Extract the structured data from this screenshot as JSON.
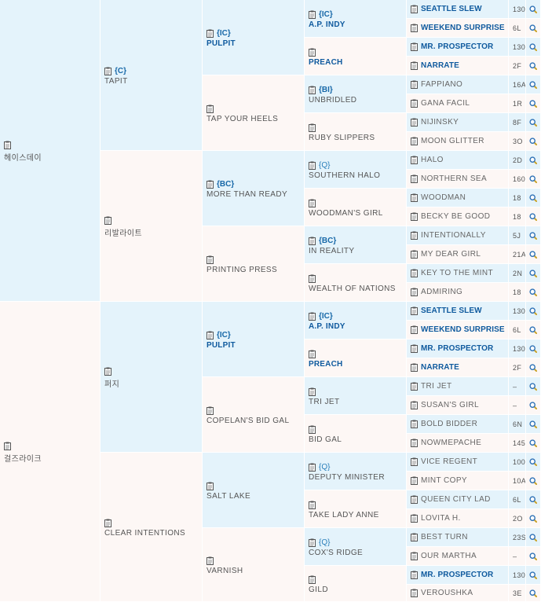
{
  "colors": {
    "male_bg": "#e4f3fb",
    "female_bg": "#fdf7f5",
    "link": "#0f5a9e"
  },
  "icons": {
    "record": "clipboard-icon",
    "search": "magnifier-icon"
  },
  "gen1": [
    {
      "name": "헤이스데이",
      "sex": "m"
    },
    {
      "name": "걸즈라이크",
      "sex": "f"
    }
  ],
  "gen2": [
    {
      "code": "{C}",
      "name": "TAPIT",
      "sex": "m"
    },
    {
      "code": "",
      "name": "리발라이트",
      "sex": "f"
    },
    {
      "code": "",
      "name": "퍼지",
      "sex": "m"
    },
    {
      "code": "",
      "name": "CLEAR INTENTIONS",
      "sex": "f"
    }
  ],
  "gen3": [
    {
      "code": "{IC}",
      "name": "PULPIT",
      "bold": true,
      "sex": "m"
    },
    {
      "code": "",
      "name": "TAP YOUR HEELS",
      "sex": "f"
    },
    {
      "code": "{BC}",
      "name": "MORE THAN READY",
      "sex": "m"
    },
    {
      "code": "",
      "name": "PRINTING PRESS",
      "sex": "f"
    },
    {
      "code": "{IC}",
      "name": "PULPIT",
      "bold": true,
      "sex": "m"
    },
    {
      "code": "",
      "name": "COPELAN'S BID GAL",
      "sex": "f"
    },
    {
      "code": "",
      "name": "SALT LAKE",
      "sex": "m"
    },
    {
      "code": "",
      "name": "VARNISH",
      "sex": "f"
    }
  ],
  "gen4": [
    {
      "code": "{IC}",
      "name": "A.P. INDY",
      "bold": true,
      "sex": "m"
    },
    {
      "code": "",
      "name": "PREACH",
      "bold": true,
      "sex": "f"
    },
    {
      "code": "{BI}",
      "name": "UNBRIDLED",
      "sex": "m"
    },
    {
      "code": "",
      "name": "RUBY SLIPPERS",
      "sex": "f"
    },
    {
      "code": "{Q}",
      "name": "SOUTHERN HALO",
      "thin": true,
      "sex": "m"
    },
    {
      "code": "",
      "name": "WOODMAN'S GIRL",
      "sex": "f"
    },
    {
      "code": "{BC}",
      "name": "IN REALITY",
      "sex": "m"
    },
    {
      "code": "",
      "name": "WEALTH OF NATIONS",
      "sex": "f"
    },
    {
      "code": "{IC}",
      "name": "A.P. INDY",
      "bold": true,
      "sex": "m"
    },
    {
      "code": "",
      "name": "PREACH",
      "bold": true,
      "sex": "f"
    },
    {
      "code": "",
      "name": "TRI JET",
      "sex": "m"
    },
    {
      "code": "",
      "name": "BID GAL",
      "sex": "f"
    },
    {
      "code": "{Q}",
      "name": "DEPUTY MINISTER",
      "thin": true,
      "sex": "m"
    },
    {
      "code": "",
      "name": "TAKE LADY ANNE",
      "sex": "f"
    },
    {
      "code": "{Q}",
      "name": "COX'S RIDGE",
      "thin": true,
      "sex": "m"
    },
    {
      "code": "",
      "name": "GILD",
      "sex": "f"
    }
  ],
  "gen5": [
    {
      "name": "SEATTLE SLEW",
      "num": "130",
      "bold": true,
      "sex": "m"
    },
    {
      "name": "WEEKEND SURPRISE",
      "num": "6L",
      "bold": true,
      "sex": "f"
    },
    {
      "name": "MR. PROSPECTOR",
      "num": "130",
      "bold": true,
      "sex": "m"
    },
    {
      "name": "NARRATE",
      "num": "2F",
      "bold": true,
      "sex": "f"
    },
    {
      "name": "FAPPIANO",
      "num": "16A",
      "sex": "m"
    },
    {
      "name": "GANA FACIL",
      "num": "1R",
      "sex": "f"
    },
    {
      "name": "NIJINSKY",
      "num": "8F",
      "sex": "m"
    },
    {
      "name": "MOON GLITTER",
      "num": "3O",
      "sex": "f"
    },
    {
      "name": "HALO",
      "num": "2D",
      "sex": "m"
    },
    {
      "name": "NORTHERN SEA",
      "num": "160",
      "sex": "f"
    },
    {
      "name": "WOODMAN",
      "num": "18",
      "sex": "m"
    },
    {
      "name": "BECKY BE GOOD",
      "num": "18",
      "sex": "f"
    },
    {
      "name": "INTENTIONALLY",
      "num": "5J",
      "sex": "m"
    },
    {
      "name": "MY DEAR GIRL",
      "num": "21A",
      "sex": "f"
    },
    {
      "name": "KEY TO THE MINT",
      "num": "2N",
      "sex": "m"
    },
    {
      "name": "ADMIRING",
      "num": "18",
      "sex": "f"
    },
    {
      "name": "SEATTLE SLEW",
      "num": "130",
      "bold": true,
      "sex": "m"
    },
    {
      "name": "WEEKEND SURPRISE",
      "num": "6L",
      "bold": true,
      "sex": "f"
    },
    {
      "name": "MR. PROSPECTOR",
      "num": "130",
      "bold": true,
      "sex": "m"
    },
    {
      "name": "NARRATE",
      "num": "2F",
      "bold": true,
      "sex": "f"
    },
    {
      "name": "TRI JET",
      "num": "–",
      "sex": "m"
    },
    {
      "name": "SUSAN'S GIRL",
      "num": "–",
      "sex": "f"
    },
    {
      "name": "BOLD BIDDER",
      "num": "6N",
      "sex": "m"
    },
    {
      "name": "NOWMEPACHE",
      "num": "145",
      "sex": "f"
    },
    {
      "name": "VICE REGENT",
      "num": "100",
      "sex": "m"
    },
    {
      "name": "MINT COPY",
      "num": "10A",
      "sex": "f"
    },
    {
      "name": "QUEEN CITY LAD",
      "num": "6L",
      "sex": "m"
    },
    {
      "name": "LOVITA H.",
      "num": "2O",
      "sex": "f"
    },
    {
      "name": "BEST TURN",
      "num": "23S",
      "sex": "m"
    },
    {
      "name": "OUR MARTHA",
      "num": "–",
      "sex": "f"
    },
    {
      "name": "MR. PROSPECTOR",
      "num": "130",
      "bold": true,
      "sex": "m"
    },
    {
      "name": "VEROUSHKA",
      "num": "3E",
      "sex": "f"
    }
  ]
}
